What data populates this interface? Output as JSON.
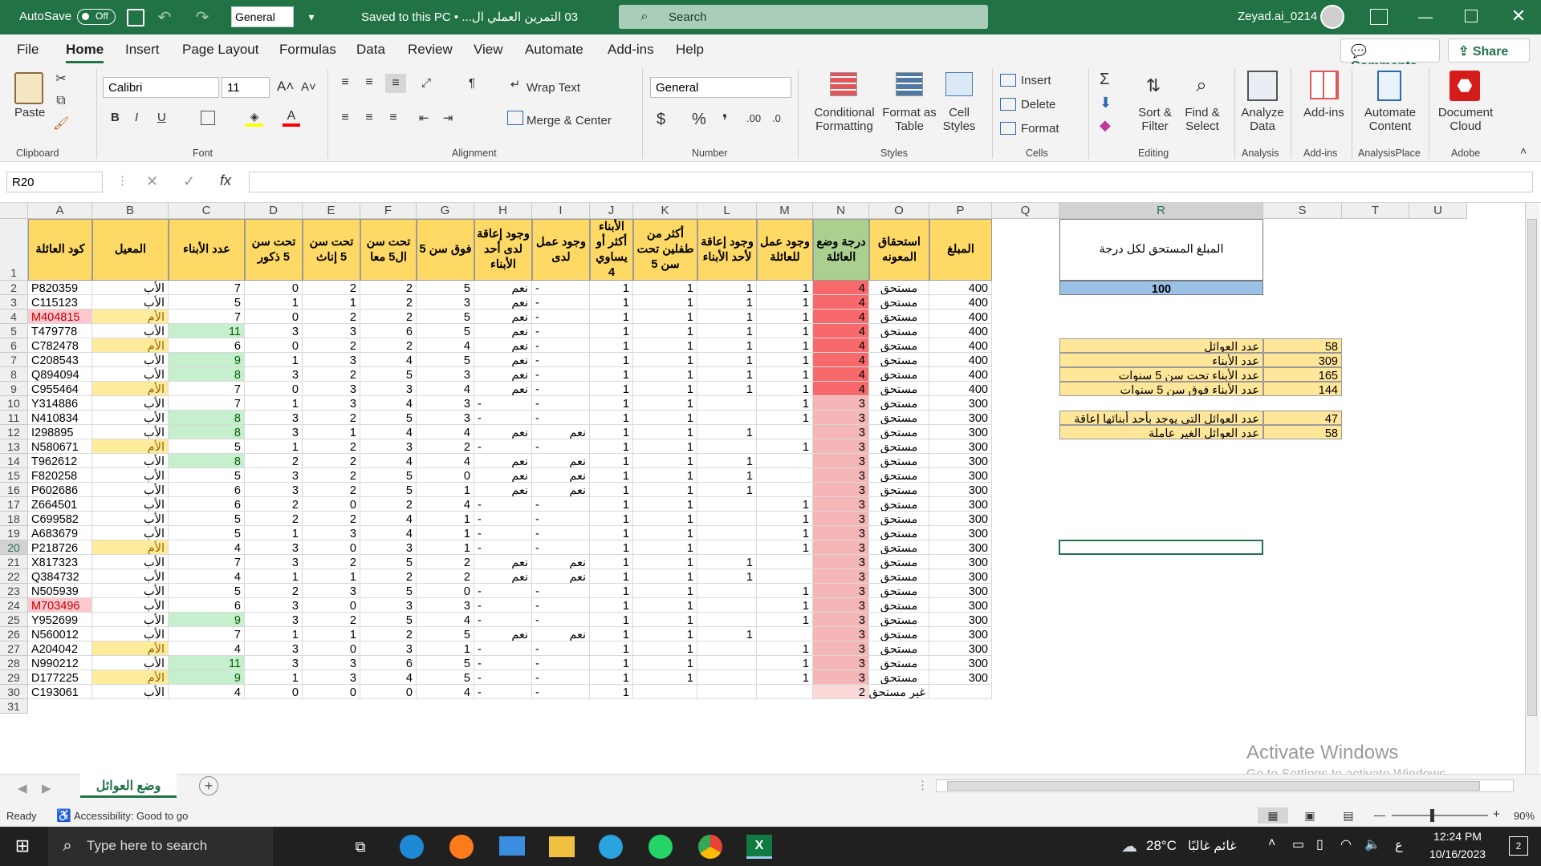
{
  "titlebar": {
    "autosave": "AutoSave",
    "toggle": "Off",
    "format": "General",
    "doc": "03 التمرين العملي ال... • Saved to this PC",
    "search": "Search",
    "user": "Zeyad.ai_0214"
  },
  "menu": {
    "tabs": [
      "File",
      "Home",
      "Insert",
      "Page Layout",
      "Formulas",
      "Data",
      "Review",
      "View",
      "Automate",
      "Add-ins",
      "Help"
    ],
    "comments": "Comments",
    "share": "Share"
  },
  "ribbon": {
    "paste": "Paste",
    "clipboard": "Clipboard",
    "font_name": "Calibri",
    "font_size": "11",
    "font": "Font",
    "wrap": "Wrap Text",
    "merge": "Merge & Center",
    "alignment": "Alignment",
    "num_format": "General",
    "number": "Number",
    "cond": [
      "Conditional",
      "Formatting"
    ],
    "fmt_table": [
      "Format as",
      "Table"
    ],
    "cell_styles": [
      "Cell",
      "Styles"
    ],
    "styles": "Styles",
    "insert": "Insert",
    "delete": "Delete",
    "format": "Format",
    "cells": "Cells",
    "sort": [
      "Sort &",
      "Filter"
    ],
    "find": [
      "Find &",
      "Select"
    ],
    "editing": "Editing",
    "analyze": [
      "Analyze",
      "Data"
    ],
    "analysis": "Analysis",
    "addins": "Add-ins",
    "addins_g": "Add-ins",
    "automate": [
      "Automate",
      "Content"
    ],
    "analysisplace": "AnalysisPlace",
    "doccloud": [
      "Document",
      "Cloud"
    ],
    "adobe": "Adobe"
  },
  "formula": {
    "namebox": "R20",
    "fx": "fx"
  },
  "columns": [
    "A",
    "B",
    "C",
    "D",
    "E",
    "F",
    "G",
    "H",
    "I",
    "J",
    "K",
    "L",
    "M",
    "N",
    "O",
    "P",
    "Q",
    "R",
    "S",
    "T",
    "U"
  ],
  "headers": [
    "كود العائلة",
    "المعيل",
    "عدد الأبناء",
    "تحت سن 5 ذكور",
    "تحت سن 5 إناث",
    "تحت سن ال5 معا",
    "فوق سن 5",
    "وجود إعاقة لدى أحد الأبناء",
    "وجود عمل لدى",
    "الأبناء أكثر أو يساوي 4",
    "أكثر من طفلين تحت سن 5",
    "وجود إعاقة لأحد الأبناء",
    "وجود عمل للعائلة",
    "درجة وضع العائلة",
    "استحقاق المعونه",
    "المبلغ"
  ],
  "rows": [
    [
      "P820359",
      "الأب",
      "7",
      "0",
      "2",
      "2",
      "5",
      "نعم",
      "-",
      "1",
      "1",
      "1",
      "1",
      "4",
      "مستحق",
      "400"
    ],
    [
      "C115123",
      "الأب",
      "5",
      "1",
      "1",
      "2",
      "3",
      "نعم",
      "-",
      "1",
      "1",
      "1",
      "1",
      "4",
      "مستحق",
      "400"
    ],
    [
      "M404815",
      "الأم",
      "7",
      "0",
      "2",
      "2",
      "5",
      "نعم",
      "-",
      "1",
      "1",
      "1",
      "1",
      "4",
      "مستحق",
      "400"
    ],
    [
      "T479778",
      "الأب",
      "11",
      "3",
      "3",
      "6",
      "5",
      "نعم",
      "-",
      "1",
      "1",
      "1",
      "1",
      "4",
      "مستحق",
      "400"
    ],
    [
      "C782478",
      "الأم",
      "6",
      "0",
      "2",
      "2",
      "4",
      "نعم",
      "-",
      "1",
      "1",
      "1",
      "1",
      "4",
      "مستحق",
      "400"
    ],
    [
      "C208543",
      "الأب",
      "9",
      "1",
      "3",
      "4",
      "5",
      "نعم",
      "-",
      "1",
      "1",
      "1",
      "1",
      "4",
      "مستحق",
      "400"
    ],
    [
      "Q894094",
      "الأب",
      "8",
      "3",
      "2",
      "5",
      "3",
      "نعم",
      "-",
      "1",
      "1",
      "1",
      "1",
      "4",
      "مستحق",
      "400"
    ],
    [
      "C955464",
      "الأم",
      "7",
      "0",
      "3",
      "3",
      "4",
      "نعم",
      "-",
      "1",
      "1",
      "1",
      "1",
      "4",
      "مستحق",
      "400"
    ],
    [
      "Y314886",
      "الأب",
      "7",
      "1",
      "3",
      "4",
      "3",
      "-",
      "-",
      "1",
      "1",
      "",
      "1",
      "3",
      "مستحق",
      "300"
    ],
    [
      "N410834",
      "الأب",
      "8",
      "3",
      "2",
      "5",
      "3",
      "-",
      "-",
      "1",
      "1",
      "",
      "1",
      "3",
      "مستحق",
      "300"
    ],
    [
      "I298895",
      "الأب",
      "8",
      "3",
      "1",
      "4",
      "4",
      "نعم",
      "نعم",
      "1",
      "1",
      "1",
      "",
      "3",
      "مستحق",
      "300"
    ],
    [
      "N580671",
      "الأم",
      "5",
      "1",
      "2",
      "3",
      "2",
      "-",
      "-",
      "1",
      "1",
      "",
      "1",
      "3",
      "مستحق",
      "300"
    ],
    [
      "T962612",
      "الأب",
      "8",
      "2",
      "2",
      "4",
      "4",
      "نعم",
      "نعم",
      "1",
      "1",
      "1",
      "",
      "3",
      "مستحق",
      "300"
    ],
    [
      "F820258",
      "الأب",
      "5",
      "3",
      "2",
      "5",
      "0",
      "نعم",
      "نعم",
      "1",
      "1",
      "1",
      "",
      "3",
      "مستحق",
      "300"
    ],
    [
      "P602686",
      "الأب",
      "6",
      "3",
      "2",
      "5",
      "1",
      "نعم",
      "نعم",
      "1",
      "1",
      "1",
      "",
      "3",
      "مستحق",
      "300"
    ],
    [
      "Z664501",
      "الأب",
      "6",
      "2",
      "0",
      "2",
      "4",
      "-",
      "-",
      "1",
      "1",
      "",
      "1",
      "3",
      "مستحق",
      "300"
    ],
    [
      "C699582",
      "الأب",
      "5",
      "2",
      "2",
      "4",
      "1",
      "-",
      "-",
      "1",
      "1",
      "",
      "1",
      "3",
      "مستحق",
      "300"
    ],
    [
      "A683679",
      "الأب",
      "5",
      "1",
      "3",
      "4",
      "1",
      "-",
      "-",
      "1",
      "1",
      "",
      "1",
      "3",
      "مستحق",
      "300"
    ],
    [
      "P218726",
      "الأم",
      "4",
      "3",
      "0",
      "3",
      "1",
      "-",
      "-",
      "1",
      "1",
      "",
      "1",
      "3",
      "مستحق",
      "300"
    ],
    [
      "X817323",
      "الأب",
      "7",
      "3",
      "2",
      "5",
      "2",
      "نعم",
      "نعم",
      "1",
      "1",
      "1",
      "",
      "3",
      "مستحق",
      "300"
    ],
    [
      "Q384732",
      "الأب",
      "4",
      "1",
      "1",
      "2",
      "2",
      "نعم",
      "نعم",
      "1",
      "1",
      "1",
      "",
      "3",
      "مستحق",
      "300"
    ],
    [
      "N505939",
      "الأب",
      "5",
      "2",
      "3",
      "5",
      "0",
      "-",
      "-",
      "1",
      "1",
      "",
      "1",
      "3",
      "مستحق",
      "300"
    ],
    [
      "M703496",
      "الأب",
      "6",
      "3",
      "0",
      "3",
      "3",
      "-",
      "-",
      "1",
      "1",
      "",
      "1",
      "3",
      "مستحق",
      "300"
    ],
    [
      "Y952699",
      "الأب",
      "9",
      "3",
      "2",
      "5",
      "4",
      "-",
      "-",
      "1",
      "1",
      "",
      "1",
      "3",
      "مستحق",
      "300"
    ],
    [
      "N560012",
      "الأب",
      "7",
      "1",
      "1",
      "2",
      "5",
      "نعم",
      "نعم",
      "1",
      "1",
      "1",
      "",
      "3",
      "مستحق",
      "300"
    ],
    [
      "A204042",
      "الأم",
      "4",
      "3",
      "0",
      "3",
      "1",
      "-",
      "-",
      "1",
      "1",
      "",
      "1",
      "3",
      "مستحق",
      "300"
    ],
    [
      "N990212",
      "الأب",
      "11",
      "3",
      "3",
      "6",
      "5",
      "-",
      "-",
      "1",
      "1",
      "",
      "1",
      "3",
      "مستحق",
      "300"
    ],
    [
      "D177225",
      "الأم",
      "9",
      "1",
      "3",
      "4",
      "5",
      "-",
      "-",
      "1",
      "1",
      "",
      "1",
      "3",
      "مستحق",
      "300"
    ],
    [
      "C193061",
      "الأب",
      "4",
      "0",
      "0",
      "0",
      "4",
      "-",
      "-",
      "1",
      "",
      "",
      "",
      "2",
      "غير مستحق",
      ""
    ]
  ],
  "side": {
    "title": "المبلغ المستحق لكل درجة",
    "value": "100",
    "stats": [
      [
        "عدد العوائل",
        "58"
      ],
      [
        "عدد الأبناء",
        "309"
      ],
      [
        "عدد الأبناء تحت سن 5 سنوات",
        "165"
      ],
      [
        "عدد الأبناء فوق سن 5 سنوات",
        "144"
      ],
      [
        "عدد العوائل التي يوجد بأحد أبنائها إعاقة",
        "47"
      ],
      [
        "عدد العوائل الغير عاملة",
        "58"
      ]
    ]
  },
  "sheet_tab": "وضع العوائل",
  "status": {
    "ready": "Ready",
    "accessibility": "Accessibility: Good to go",
    "zoom": "90%"
  },
  "watermark": {
    "line1": "Activate Windows",
    "line2": "Go to Settings to activate Windows."
  },
  "taskbar": {
    "search": "Type here to search",
    "temp": "28°C",
    "weather": "غائم غالبًا",
    "time": "12:24 PM",
    "date": "10/16/2023",
    "lang": "ع"
  },
  "colors": {
    "excel_green": "#217346",
    "header_yellow": "#ffd966",
    "green_fill": "#c6efce",
    "mother_fill": "#ffeb9c",
    "red_strong": "#f8696b",
    "red_light": "#f4b6b7",
    "side_yellow": "#ffe699",
    "side_blue": "#9bc2e6"
  }
}
